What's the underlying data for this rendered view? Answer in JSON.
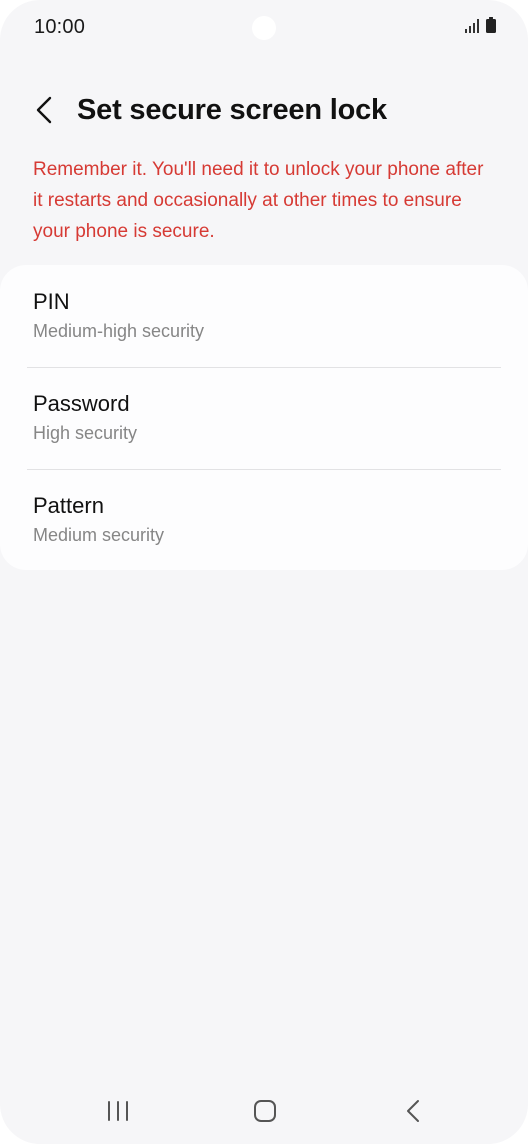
{
  "status_bar": {
    "time": "10:00",
    "icons": [
      "signal-icon",
      "battery-icon"
    ]
  },
  "header": {
    "back_icon": "chevron-left-icon",
    "title": "Set secure screen lock"
  },
  "warning": {
    "text": "Remember it. You'll need it to unlock your phone after it restarts and occasionally at other times to ensure your phone is secure.",
    "color": "#d63a34"
  },
  "options": [
    {
      "title": "PIN",
      "subtitle": "Medium-high security"
    },
    {
      "title": "Password",
      "subtitle": "High security"
    },
    {
      "title": "Pattern",
      "subtitle": "Medium security"
    }
  ],
  "nav_bar": {
    "icons": [
      "recent-apps-icon",
      "home-icon",
      "back-icon"
    ]
  },
  "colors": {
    "background": "#f6f6f8",
    "card": "#fdfdfe",
    "title_text": "#111111",
    "secondary_text": "#868686"
  }
}
